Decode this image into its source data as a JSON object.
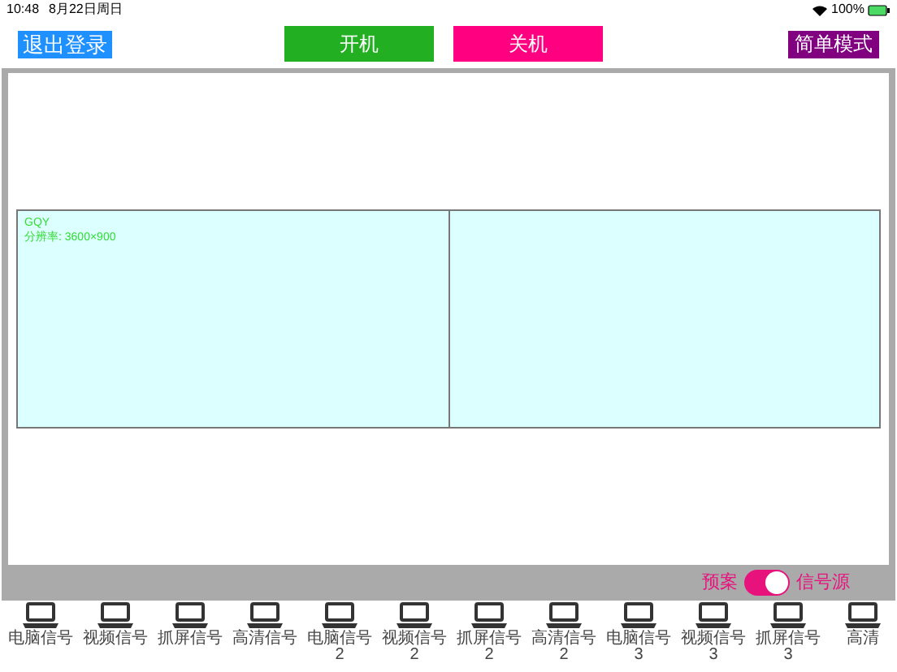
{
  "status_bar": {
    "time": "10:48",
    "date": "8月22日周日",
    "battery": "100%"
  },
  "header": {
    "logout": "退出登录",
    "power_on": "开机",
    "power_off": "关机",
    "simple_mode": "简单模式"
  },
  "screens": [
    {
      "kind": "assigned",
      "name": "GQY",
      "resolution": "分辨率: 3600×900"
    },
    {
      "kind": "empty"
    }
  ],
  "mode_toggle": {
    "left_label": "预案",
    "right_label": "信号源",
    "on": true
  },
  "sources": [
    {
      "label": "电脑信号"
    },
    {
      "label": "视频信号"
    },
    {
      "label": "抓屏信号"
    },
    {
      "label": "高清信号"
    },
    {
      "label": "电脑信号 2"
    },
    {
      "label": "视频信号 2"
    },
    {
      "label": "抓屏信号 2"
    },
    {
      "label": "高清信号 2"
    },
    {
      "label": "电脑信号 3"
    },
    {
      "label": "视频信号 3"
    },
    {
      "label": "抓屏信号 3"
    },
    {
      "label": "高清"
    }
  ]
}
